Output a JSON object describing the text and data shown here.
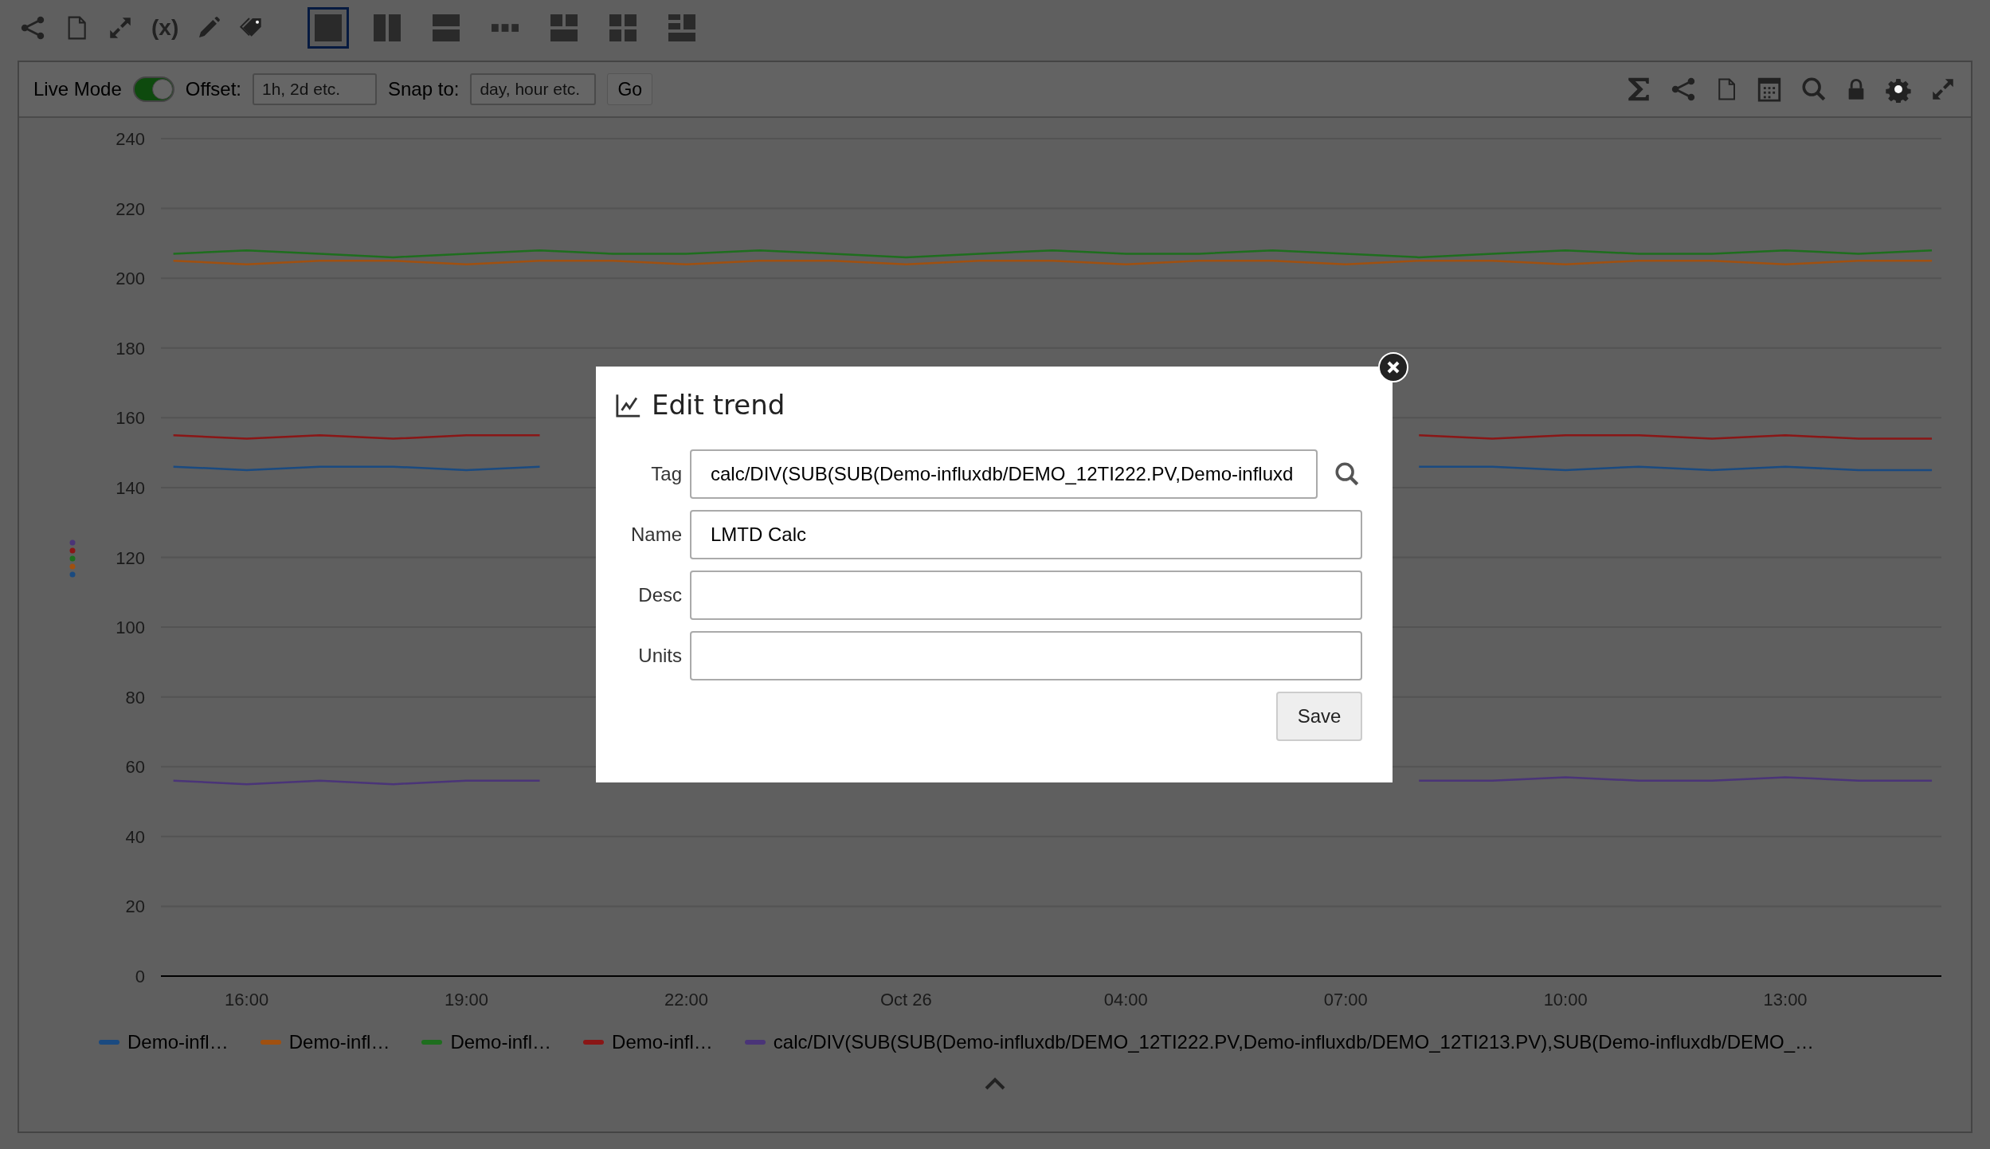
{
  "top_toolbar": {
    "variables_label": "(x)",
    "layouts": [
      {
        "kind": "single",
        "selected": true
      },
      {
        "kind": "columns",
        "selected": false
      },
      {
        "kind": "rows",
        "selected": false
      },
      {
        "kind": "strip",
        "selected": false
      },
      {
        "kind": "two-one",
        "selected": false
      },
      {
        "kind": "grid",
        "selected": false
      },
      {
        "kind": "mixed",
        "selected": false
      }
    ]
  },
  "chart_toolbar": {
    "live_mode": {
      "label": "Live Mode",
      "on": true
    },
    "offset": {
      "label": "Offset:",
      "placeholder": "1h, 2d etc."
    },
    "snap": {
      "label": "Snap to:",
      "placeholder": "day, hour etc."
    },
    "go_button": "Go"
  },
  "chart": {
    "chart_data": {
      "type": "line",
      "categories": [
        null,
        "16:00",
        null,
        null,
        "19:00",
        null,
        null,
        "22:00",
        null,
        null,
        "Oct 26",
        null,
        null,
        "04:00",
        null,
        null,
        "07:00",
        null,
        null,
        "10:00",
        null,
        null,
        "13:00",
        null,
        null
      ],
      "ylim": [
        0,
        240
      ],
      "yticks": [
        0,
        20,
        40,
        60,
        80,
        100,
        120,
        140,
        160,
        180,
        200,
        220,
        240
      ],
      "grid": true,
      "series": [
        {
          "name": "Demo-infl…",
          "color": "#1a4a80",
          "values": [
            146,
            145,
            146,
            146,
            145,
            146,
            null,
            null,
            null,
            null,
            null,
            null,
            null,
            null,
            null,
            null,
            null,
            146,
            146,
            145,
            146,
            145,
            146,
            145,
            145
          ]
        },
        {
          "name": "Demo-infl…",
          "color": "#a05010",
          "values": [
            205,
            204,
            205,
            205,
            204,
            205,
            205,
            204,
            205,
            205,
            204,
            205,
            205,
            204,
            205,
            205,
            204,
            205,
            205,
            204,
            205,
            205,
            204,
            205,
            205
          ]
        },
        {
          "name": "Demo-infl…",
          "color": "#1e6e1e",
          "values": [
            207,
            208,
            207,
            206,
            207,
            208,
            207,
            207,
            208,
            207,
            206,
            207,
            208,
            207,
            207,
            208,
            207,
            206,
            207,
            208,
            207,
            207,
            208,
            207,
            208
          ]
        },
        {
          "name": "Demo-infl…",
          "color": "#8a1616",
          "values": [
            155,
            154,
            155,
            154,
            155,
            155,
            null,
            null,
            null,
            null,
            null,
            null,
            null,
            null,
            null,
            null,
            null,
            155,
            154,
            155,
            155,
            154,
            155,
            154,
            154
          ]
        },
        {
          "name": "calc/DIV(SUB(SUB(Demo-influxdb/DEMO_12TI222.PV,Demo-influxdb/DEMO_12TI213.PV),SUB(Demo-influxdb/DEMO_…",
          "color": "#4a3478",
          "values": [
            56,
            55,
            56,
            55,
            56,
            56,
            null,
            null,
            null,
            null,
            null,
            null,
            null,
            null,
            null,
            null,
            null,
            56,
            56,
            57,
            56,
            56,
            57,
            56,
            56
          ]
        }
      ]
    }
  },
  "dialog": {
    "title": "Edit trend",
    "fields": [
      {
        "label": "Tag",
        "value": "calc/DIV(SUB(SUB(Demo-influxdb/DEMO_12TI222.PV,Demo-influxd",
        "kind": "search"
      },
      {
        "label": "Name",
        "value": "LMTD Calc",
        "kind": "text"
      },
      {
        "label": "Desc",
        "kind": "text"
      },
      {
        "label": "Units",
        "kind": "text"
      }
    ],
    "save_button": "Save"
  }
}
